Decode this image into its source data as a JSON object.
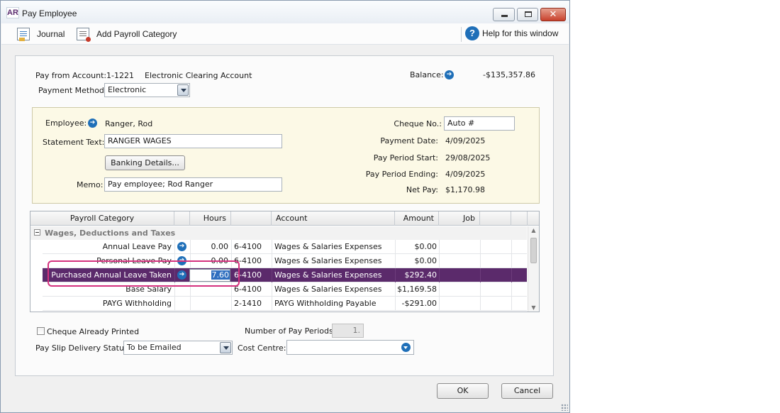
{
  "window": {
    "app_badge": "AR",
    "title": "Pay Employee",
    "close_glyph": "✕"
  },
  "toolbar": {
    "journal_label": "Journal",
    "add_category_label": "Add Payroll Category",
    "help_glyph": "?",
    "help_label": "Help for this window"
  },
  "payment": {
    "from_label": "Pay from Account:",
    "account_number": "1-1221",
    "account_name": "Electronic Clearing Account",
    "balance_label": "Balance:",
    "balance_value": "-$135,357.86",
    "method_label": "Payment Method:",
    "method_value": "Electronic"
  },
  "employee": {
    "employee_label": "Employee:",
    "employee_value": "Ranger, Rod",
    "statement_label": "Statement Text:",
    "statement_value": "RANGER WAGES",
    "banking_button": "Banking Details...",
    "memo_label": "Memo:",
    "memo_value": "Pay employee; Rod Ranger",
    "cheque_label": "Cheque No.:",
    "cheque_value": "Auto #",
    "payment_date_label": "Payment Date:",
    "payment_date_value": "4/09/2025",
    "period_start_label": "Pay Period Start:",
    "period_start_value": "29/08/2025",
    "period_end_label": "Pay Period Ending:",
    "period_end_value": "4/09/2025",
    "net_pay_label": "Net Pay:",
    "net_pay_value": "$1,170.98"
  },
  "grid": {
    "headers": {
      "category": "Payroll Category",
      "hours": "Hours",
      "account": "Account",
      "amount": "Amount",
      "job": "Job"
    },
    "group_label": "Wages, Deductions and Taxes",
    "rows": [
      {
        "category": "Annual Leave Pay",
        "hours": "0.00",
        "account_number": "6-4100",
        "account_name": "Wages & Salaries Expenses",
        "amount": "$0.00"
      },
      {
        "category": "Personal Leave Pay",
        "hours": "0.00",
        "account_number": "6-4100",
        "account_name": "Wages & Salaries Expenses",
        "amount": "$0.00"
      },
      {
        "category": "Purchased Annual Leave Taken",
        "hours": "7.60",
        "account_number": "6-4100",
        "account_name": "Wages & Salaries Expenses",
        "amount": "$292.40"
      },
      {
        "category": "Base Salary",
        "hours": "",
        "account_number": "6-4100",
        "account_name": "Wages & Salaries Expenses",
        "amount": "$1,169.58"
      },
      {
        "category": "PAYG Withholding",
        "hours": "",
        "account_number": "2-1410",
        "account_name": "PAYG Withholding Payable",
        "amount": "-$291.00"
      }
    ]
  },
  "footer": {
    "cheque_printed_label": "Cheque Already Printed",
    "pay_periods_label": "Number of Pay Periods:",
    "pay_periods_value": "1.",
    "delivery_label": "Pay Slip Delivery Status:",
    "delivery_value": "To be Emailed",
    "cost_centre_label": "Cost Centre:",
    "cost_centre_value": "",
    "ok_label": "OK",
    "cancel_label": "Cancel"
  },
  "colors": {
    "selection": "#5b2a6b",
    "employee_panel": "#fcf9e6",
    "highlight": "#d4317e",
    "link_arrow": "#1f6fb8"
  }
}
